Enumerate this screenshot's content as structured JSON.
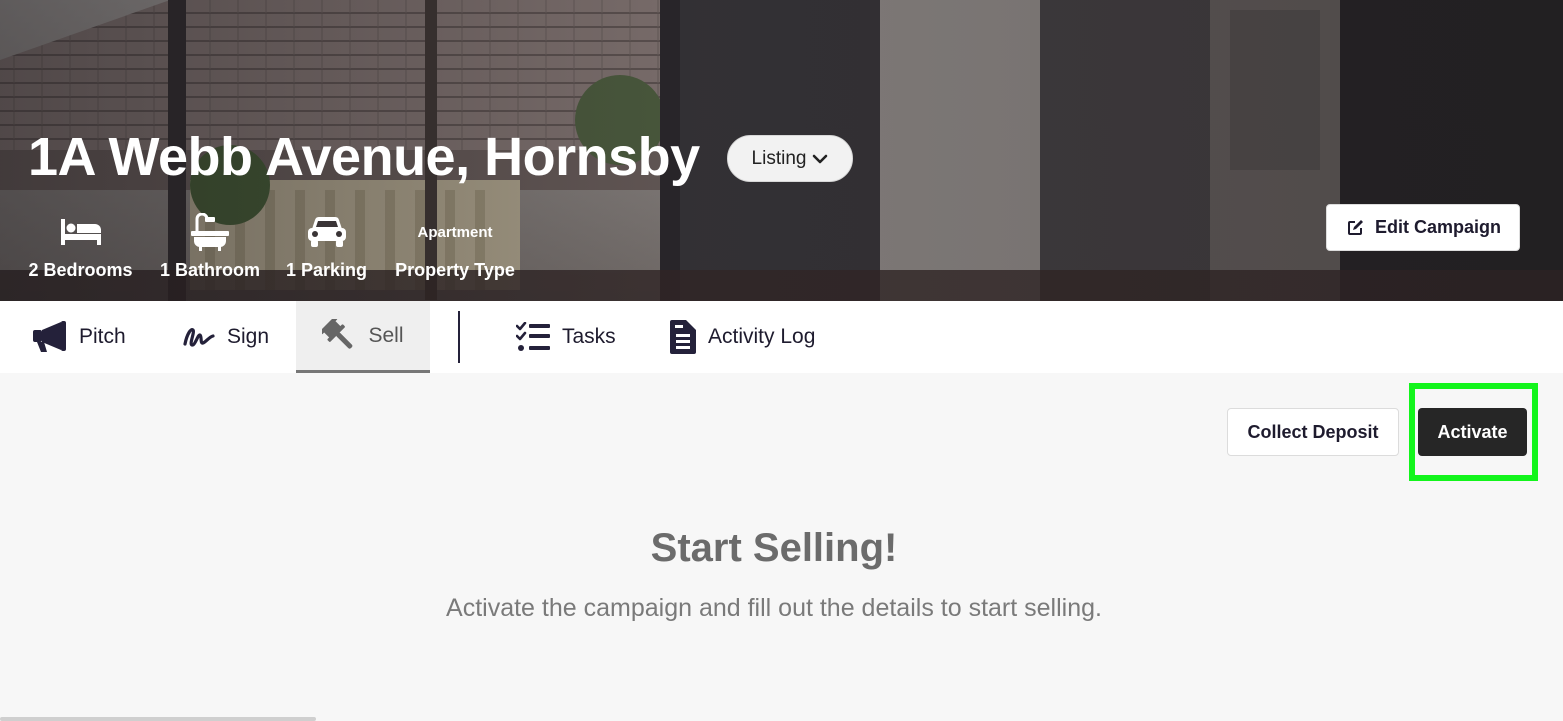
{
  "hero": {
    "title": "1A Webb Avenue, Hornsby",
    "status_pill": "Listing",
    "features": [
      {
        "icon": "bed-icon",
        "label": "2 Bedrooms"
      },
      {
        "icon": "bath-icon",
        "label": "1 Bathroom"
      },
      {
        "icon": "car-icon",
        "label": "1 Parking"
      },
      {
        "value": "Apartment",
        "label": "Property Type"
      }
    ],
    "edit_button": "Edit Campaign"
  },
  "tabs": [
    {
      "icon": "megaphone-icon",
      "label": "Pitch"
    },
    {
      "icon": "signature-icon",
      "label": "Sign"
    },
    {
      "icon": "gavel-icon",
      "label": "Sell",
      "active": true
    },
    {
      "icon": "tasks-icon",
      "label": "Tasks"
    },
    {
      "icon": "document-icon",
      "label": "Activity Log"
    }
  ],
  "actions": {
    "collect_deposit": "Collect Deposit",
    "activate": "Activate"
  },
  "empty_state": {
    "title": "Start Selling!",
    "subtitle": "Activate the campaign and fill out the details to start selling."
  },
  "colors": {
    "highlight": "#13f51c",
    "primary_dark": "#262626",
    "ink": "#1e1b2e"
  }
}
